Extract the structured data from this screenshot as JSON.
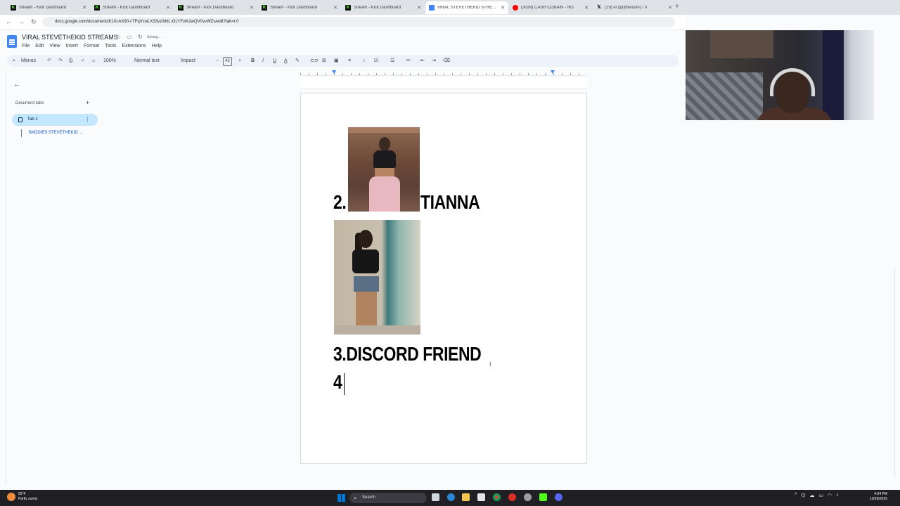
{
  "browser": {
    "tabs": [
      {
        "label": "Stream - Kick Dashboard",
        "favicon": "kick",
        "active": false
      },
      {
        "label": "Stream - Kick Dashboard",
        "favicon": "kick",
        "active": false
      },
      {
        "label": "Stream - Kick Dashboard",
        "favicon": "kick",
        "active": false
      },
      {
        "label": "Stream - Kick Dashboard",
        "favicon": "kick",
        "active": false
      },
      {
        "label": "Stream - Kick Dashboard",
        "favicon": "kick",
        "active": false
      },
      {
        "label": "VIRAL STEVETHEKID STREAMS",
        "favicon": "docs",
        "active": true
      },
      {
        "label": "(3039) CASH COBAIN - NO",
        "favicon": "youtube",
        "active": false
      },
      {
        "label": "(19) el (@jittwustin) / X",
        "favicon": "x",
        "active": false
      }
    ],
    "new_tab_label": "+",
    "url": "docs.google.com/document/d/1XcAX90-cTFqVzwLX33vz0ihlL-GLYFvlA2wQV0vvWZs/edit?tab=t.0"
  },
  "doc": {
    "title": "VIRAL STEVETHEKID STREAMS",
    "saving_status": "Saving...",
    "menu": [
      "File",
      "Edit",
      "View",
      "Insert",
      "Format",
      "Tools",
      "Extensions",
      "Help"
    ]
  },
  "toolbar": {
    "menus_label": "Menus",
    "zoom": "100%",
    "style": "Normal text",
    "font": "Impact",
    "font_size": "43",
    "minus": "−",
    "plus": "+"
  },
  "sidebar": {
    "heading": "Document tabs",
    "add": "+",
    "tab_label": "Tab 1",
    "outline_item": "BADDIES STEVETHEKID ..."
  },
  "content": {
    "line2_number": "2.",
    "line2_name": "TIANNA",
    "line3": "3.DISCORD FRIEND",
    "line4": "4"
  },
  "taskbar": {
    "weather_temp": "55°F",
    "weather_desc": "Partly sunny",
    "search_label": "Search",
    "time": "4:04 PM",
    "date": "10/28/2025"
  },
  "colors": {
    "accent": "#4285f4",
    "active_tab_bg": "#c2e7ff",
    "kick_green": "#53fc18"
  }
}
